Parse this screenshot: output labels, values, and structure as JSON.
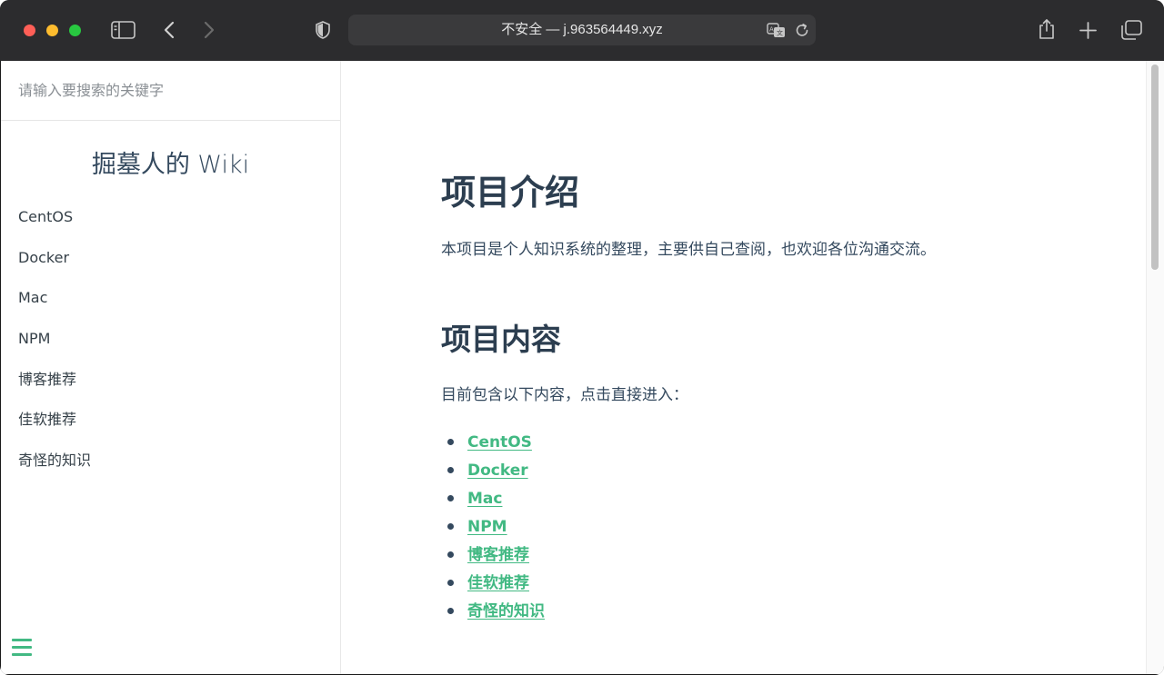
{
  "browser": {
    "url": "不安全 — j.963564449.xyz"
  },
  "sidebar": {
    "search_placeholder": "请输入要搜索的关键字",
    "app_name": "掘墓人的 Wiki",
    "items": [
      {
        "label": "CentOS"
      },
      {
        "label": "Docker"
      },
      {
        "label": "Mac"
      },
      {
        "label": "NPM"
      },
      {
        "label": "博客推荐"
      },
      {
        "label": "佳软推荐"
      },
      {
        "label": "奇怪的知识"
      }
    ]
  },
  "main": {
    "heading": "项目介绍",
    "intro": "本项目是个人知识系统的整理，主要供自己查阅，也欢迎各位沟通交流。",
    "section_heading": "项目内容",
    "section_text": "目前包含以下内容，点击直接进入：",
    "links": [
      {
        "label": "CentOS"
      },
      {
        "label": "Docker"
      },
      {
        "label": "Mac"
      },
      {
        "label": "NPM"
      },
      {
        "label": "博客推荐"
      },
      {
        "label": "佳软推荐"
      },
      {
        "label": "奇怪的知识"
      }
    ]
  },
  "colors": {
    "accent": "#42b983",
    "heading": "#2c3e50",
    "text": "#34495e",
    "toolbar": "#2c2c2e"
  },
  "icons": {
    "toolbar": [
      "sidebar-toggle-icon",
      "back-icon",
      "forward-icon",
      "privacy-shield-icon",
      "translate-icon",
      "reload-icon",
      "share-icon",
      "new-tab-icon",
      "tab-overview-icon"
    ],
    "sidebar": [
      "hamburger-menu-icon"
    ]
  }
}
